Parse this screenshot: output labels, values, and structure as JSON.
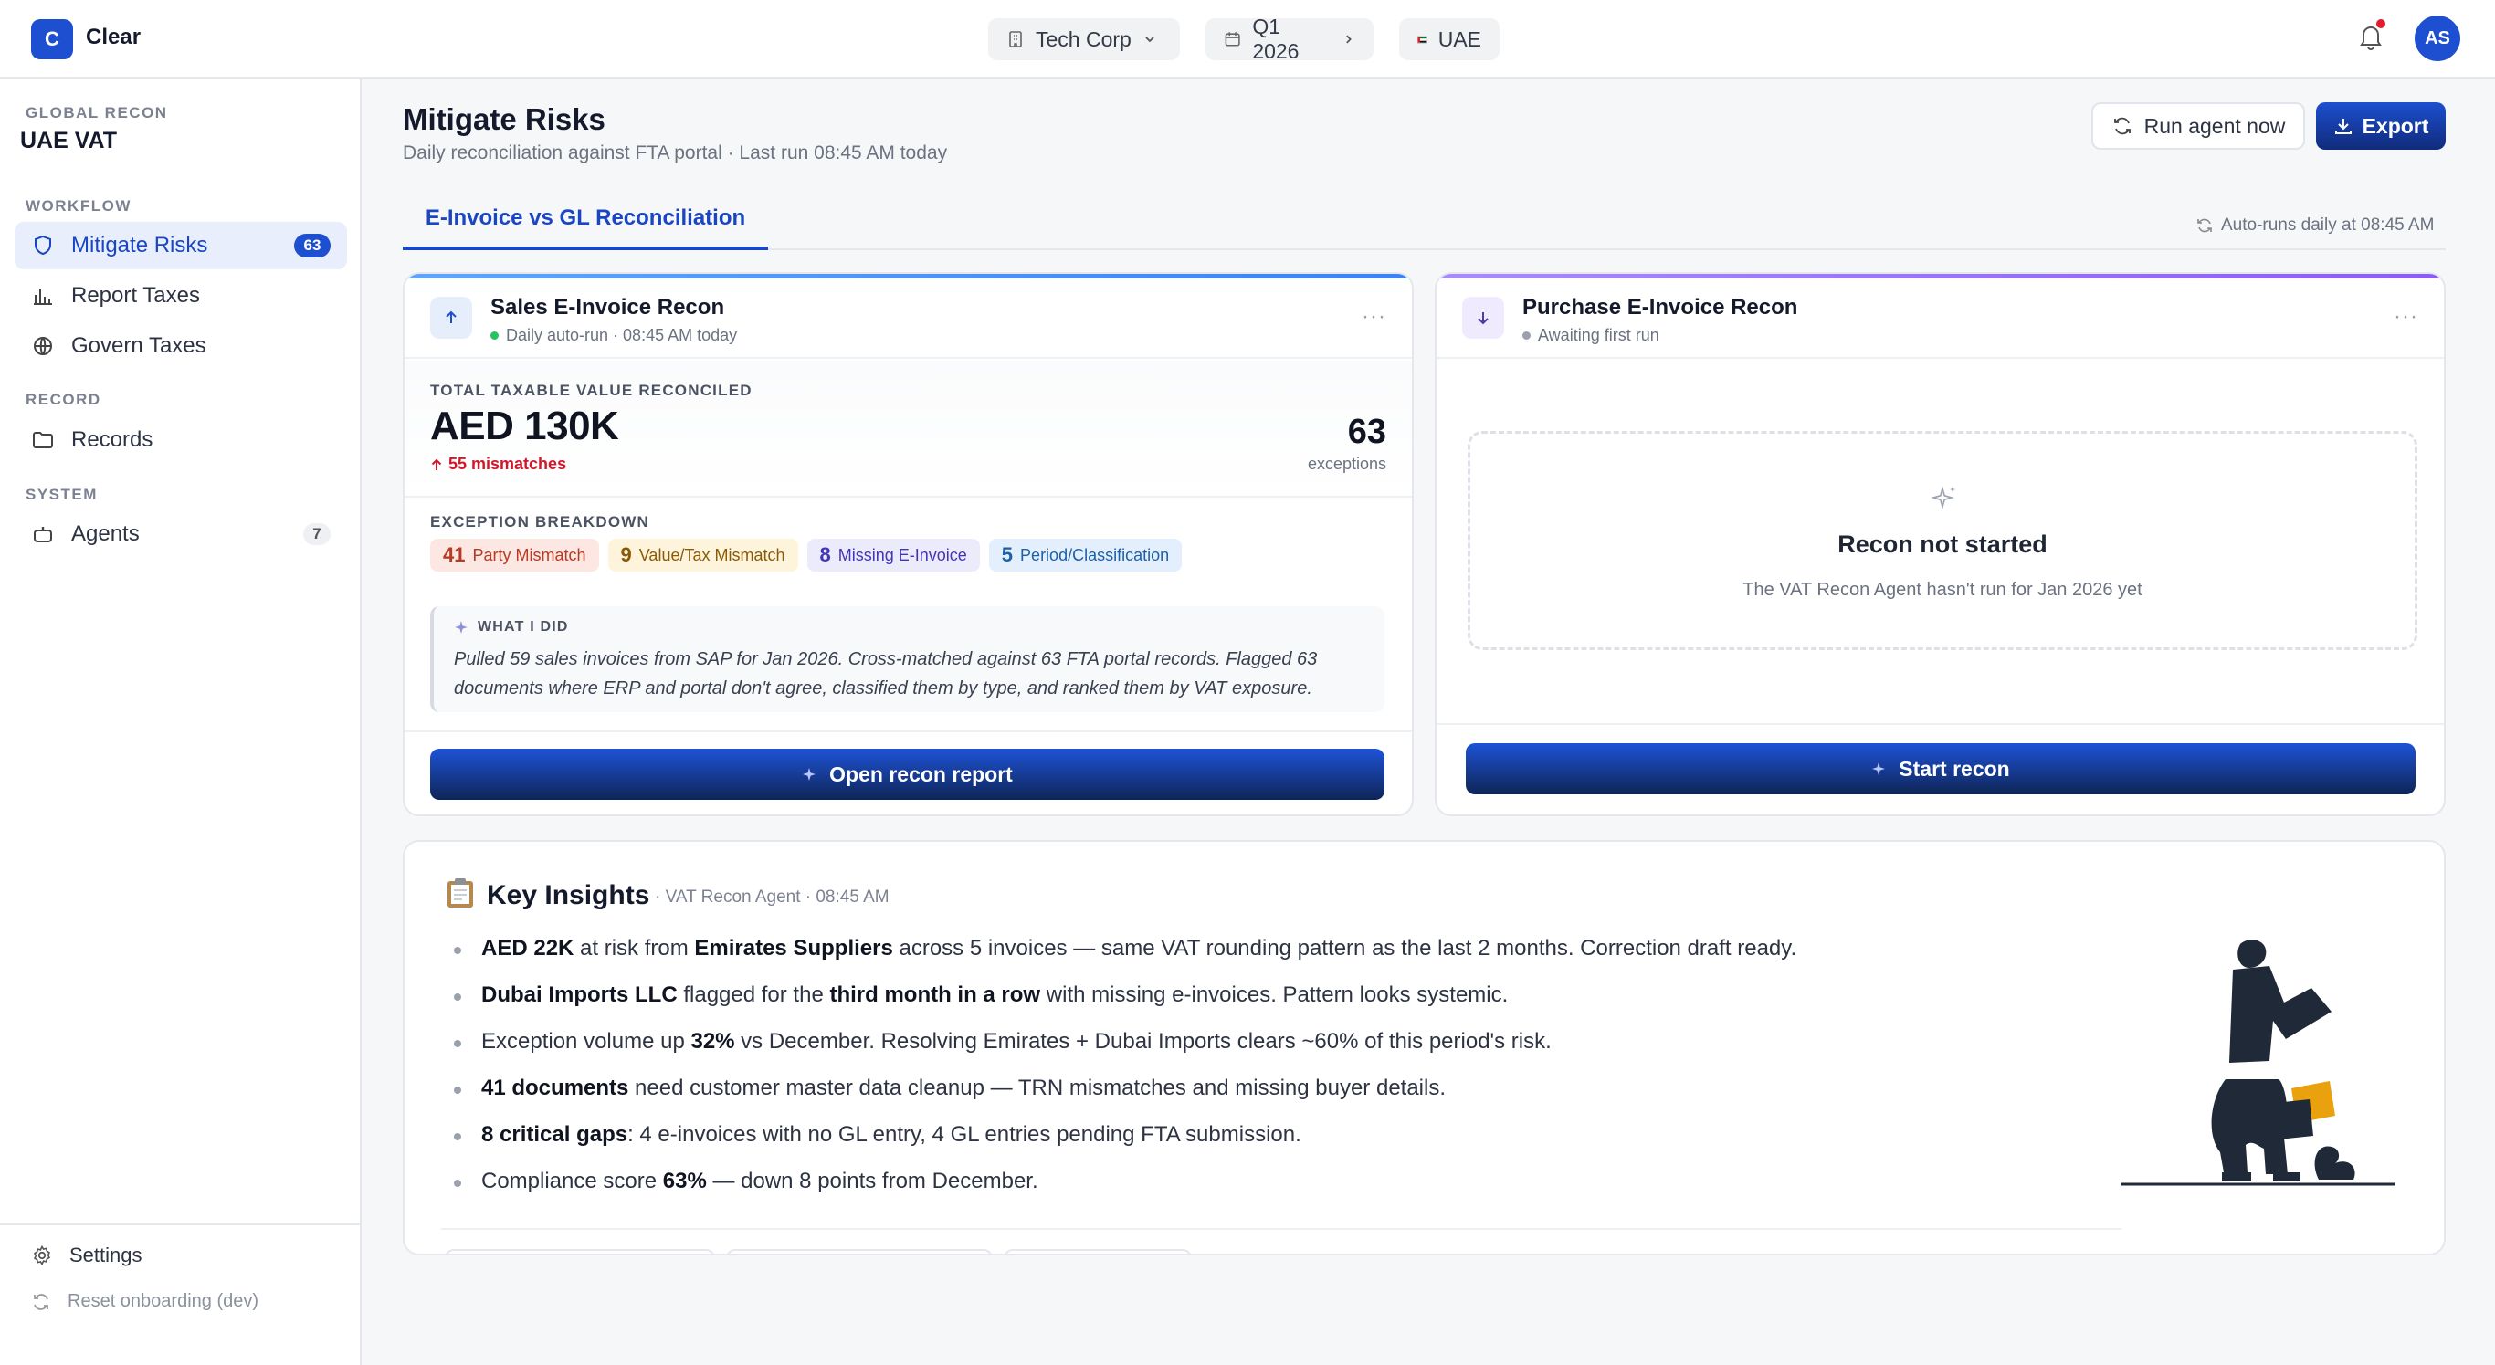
{
  "app": {
    "logo_letter": "C",
    "name": "Clear"
  },
  "topbar": {
    "company": "Tech Corp",
    "period": "Q1 2026",
    "country": "UAE",
    "avatar_initials": "AS"
  },
  "sidebar": {
    "context_label": "GLOBAL RECON",
    "context_title": "UAE VAT",
    "sections": [
      {
        "label": "WORKFLOW",
        "items": [
          {
            "label": "Mitigate Risks",
            "icon": "shield-icon",
            "badge": "63",
            "active": true
          },
          {
            "label": "Report Taxes",
            "icon": "bar-chart-icon"
          },
          {
            "label": "Govern Taxes",
            "icon": "globe-icon"
          }
        ]
      },
      {
        "label": "RECORD",
        "items": [
          {
            "label": "Records",
            "icon": "folder-icon"
          }
        ]
      },
      {
        "label": "SYSTEM",
        "items": [
          {
            "label": "Agents",
            "icon": "bot-icon",
            "badge": "7"
          }
        ]
      }
    ],
    "footer": {
      "settings": "Settings",
      "reset": "Reset onboarding (dev)"
    }
  },
  "page": {
    "title": "Mitigate Risks",
    "subtitle": "Daily reconciliation against FTA portal · Last run 08:45 AM today",
    "run_agent_label": "Run agent now",
    "export_label": "Export",
    "tab": "E-Invoice vs GL Reconciliation",
    "auto_runs": "Auto-runs daily at 08:45 AM"
  },
  "sales_card": {
    "title": "Sales E-Invoice Recon",
    "status": "Daily auto-run · 08:45 AM today",
    "kpi_label": "TOTAL TAXABLE VALUE RECONCILED",
    "kpi_value": "AED 130K",
    "mismatches": "55 mismatches",
    "exceptions_count": "63",
    "exceptions_label": "exceptions",
    "breakdown_label": "EXCEPTION BREAKDOWN",
    "chips": [
      {
        "count": "41",
        "label": "Party Mismatch",
        "bg": "#fde7e2",
        "fg": "#b83a22"
      },
      {
        "count": "9",
        "label": "Value/Tax Mismatch",
        "bg": "#fef4dc",
        "fg": "#8a5a06"
      },
      {
        "count": "8",
        "label": "Missing E-Invoice",
        "bg": "#ecebfc",
        "fg": "#4335b8"
      },
      {
        "count": "5",
        "label": "Period/Classification",
        "bg": "#e3effc",
        "fg": "#1d5fa8"
      }
    ],
    "what_label": "WHAT I DID",
    "what_line1": "Pulled 59 sales invoices from SAP for Jan 2026. Cross-matched against 63 FTA portal records. Flagged 63",
    "what_line2": "documents where ERP and portal don't agree, classified them by type, and ranked them by VAT exposure.",
    "cta": "Open recon report",
    "accent": "#3b82f6"
  },
  "purchase_card": {
    "title": "Purchase E-Invoice Recon",
    "status": "Awaiting first run",
    "empty_title": "Recon not started",
    "empty_text": "The VAT Recon Agent hasn't run for Jan 2026 yet",
    "cta": "Start recon",
    "accent": "#8b5cf6"
  },
  "insights": {
    "title": "Key Insights",
    "meta": "· VAT Recon Agent · 08:45 AM",
    "items": [
      {
        "p1b": "AED 22K",
        "p2": " at risk from ",
        "p3b": "Emirates Suppliers",
        "p4": " across 5 invoices — same VAT rounding pattern as the last 2 months. Correction draft ready."
      },
      {
        "p1b": "Dubai Imports LLC",
        "p2": " flagged for the ",
        "p3b": "third month in a row",
        "p4": " with missing e-invoices. Pattern looks systemic."
      },
      {
        "p1": "Exception volume up ",
        "p2b": "32%",
        "p3": " vs December. Resolving Emirates + Dubai Imports clears ~60% of this period's risk."
      },
      {
        "p1b": "41 documents",
        "p2": " need customer master data cleanup — TRN mismatches and missing buyer details."
      },
      {
        "p1b": "8 critical gaps",
        "p2": ": 4 e-invoices with no GL entry, 4 GL entries pending FTA submission."
      },
      {
        "p1": "Compliance score ",
        "p2b": "63%",
        "p3": " — down 8 points from December."
      }
    ]
  }
}
